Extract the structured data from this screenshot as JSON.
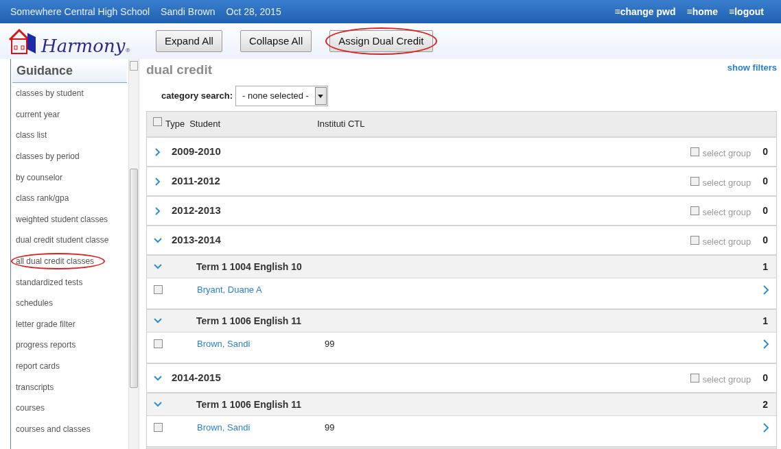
{
  "top_bar": {
    "school": "Somewhere Central High School",
    "user": "Sandi Brown",
    "date": "Oct 28, 2015",
    "links": [
      {
        "label": "≡change pwd"
      },
      {
        "label": "≡home"
      },
      {
        "label": "≡logout"
      }
    ]
  },
  "logo": {
    "text": "Harmony",
    "mark": "®"
  },
  "toolbar": [
    {
      "label": "Expand All",
      "circled": false
    },
    {
      "label": "Collapse All",
      "circled": false
    },
    {
      "label": "Assign Dual Credit",
      "circled": true
    }
  ],
  "sidebar": {
    "title": "Guidance",
    "items": [
      {
        "label": "classes by student",
        "circled": false
      },
      {
        "label": "current year",
        "circled": false
      },
      {
        "label": "class list",
        "circled": false
      },
      {
        "label": "classes by period",
        "circled": false
      },
      {
        "label": "by counselor",
        "circled": false
      },
      {
        "label": "class rank/gpa",
        "circled": false
      },
      {
        "label": "weighted student classes",
        "circled": false
      },
      {
        "label": "dual credit student classe",
        "circled": false
      },
      {
        "label": "all dual credit classes",
        "circled": true
      },
      {
        "label": "standardized tests",
        "circled": false
      },
      {
        "label": "schedules",
        "circled": false
      },
      {
        "label": "letter grade filter",
        "circled": false
      },
      {
        "label": "progress reports",
        "circled": false
      },
      {
        "label": "report cards",
        "circled": false
      },
      {
        "label": "transcripts",
        "circled": false
      },
      {
        "label": "courses",
        "circled": false
      },
      {
        "label": "courses and classes",
        "circled": false
      }
    ]
  },
  "main": {
    "title": "dual credit",
    "show_filters": "show filters",
    "category_label": "category search:",
    "category_value": "- none selected -",
    "columns": [
      "Type",
      "Student",
      "Instituti CTL"
    ],
    "header_checked": false,
    "years": [
      {
        "label": "2009-2010",
        "expanded": false,
        "select_label": "select group",
        "checked": false,
        "count": "0"
      },
      {
        "label": "2011-2012",
        "expanded": false,
        "select_label": "select group",
        "checked": false,
        "count": "0"
      },
      {
        "label": "2012-2013",
        "expanded": false,
        "select_label": "select group",
        "checked": false,
        "count": "0"
      },
      {
        "label": "2013-2014",
        "expanded": true,
        "select_label": "select group",
        "checked": false,
        "count": "0",
        "terms": [
          {
            "label": "Term 1 1004 English 10",
            "expanded": true,
            "count": "1",
            "students": [
              {
                "name": "Bryant, Duane A",
                "checked": false
              }
            ]
          },
          {
            "label": "Term 1 1006 English 11",
            "expanded": true,
            "count": "1",
            "students": [
              {
                "name": "Brown, Sandi",
                "ctl": "99",
                "checked": false
              }
            ]
          }
        ]
      },
      {
        "label": "2014-2015",
        "expanded": true,
        "select_label": "select group",
        "checked": false,
        "count": "0",
        "terms": [
          {
            "label": "Term 1 1006 English 11",
            "expanded": true,
            "count": "2",
            "students": [
              {
                "name": "Brown, Sandi",
                "ctl": "99",
                "checked": false
              }
            ]
          }
        ]
      }
    ]
  }
}
